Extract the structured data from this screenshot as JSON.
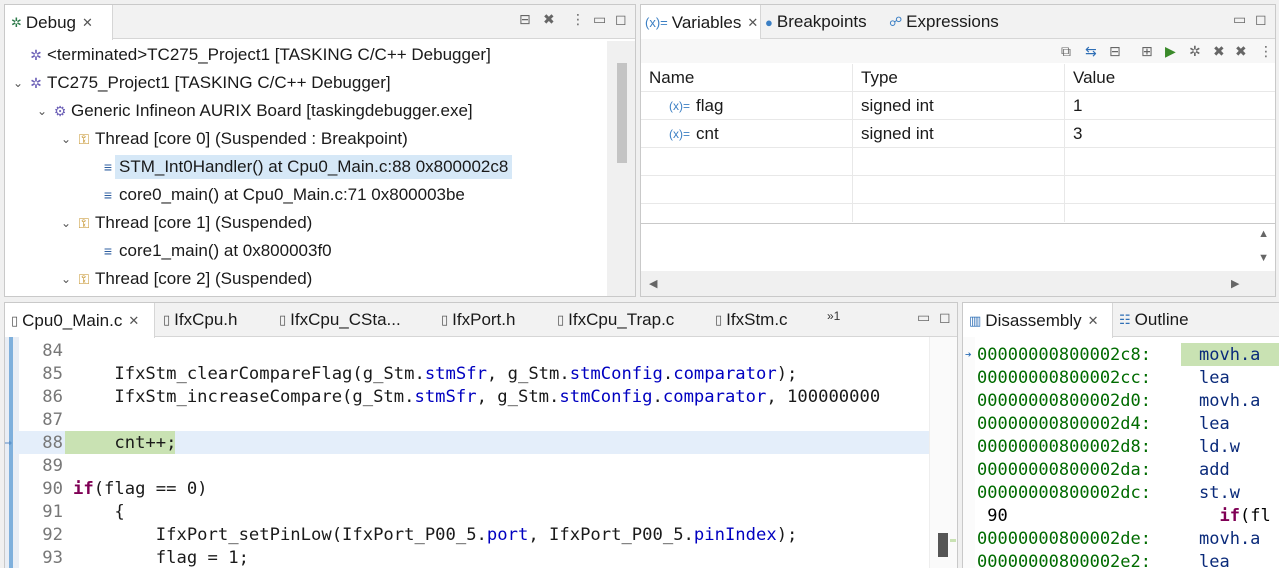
{
  "debug_view": {
    "tab_label": "Debug",
    "tree": [
      {
        "level": 1,
        "icon": "✲",
        "label": "<terminated>TC275_Project1 [TASKING C/C++ Debugger]",
        "twisty": ""
      },
      {
        "level": 1,
        "icon": "✲",
        "label": "TC275_Project1 [TASKING C/C++ Debugger]",
        "twisty": "⌄"
      },
      {
        "level": 2,
        "icon": "⚙",
        "label": "Generic Infineon AURIX Board [taskingdebugger.exe]",
        "twisty": "⌄"
      },
      {
        "level": 3,
        "icon": "⚿",
        "label": "Thread [core 0] (Suspended : Breakpoint)",
        "twisty": "⌄"
      },
      {
        "level": 4,
        "icon": "≡",
        "label": "STM_Int0Handler() at Cpu0_Main.c:88 0x800002c8",
        "twisty": "",
        "selected": true
      },
      {
        "level": 4,
        "icon": "≡",
        "label": "core0_main() at Cpu0_Main.c:71 0x800003be",
        "twisty": ""
      },
      {
        "level": 3,
        "icon": "⚿",
        "label": "Thread [core 1] (Suspended)",
        "twisty": "⌄"
      },
      {
        "level": 4,
        "icon": "≡",
        "label": "core1_main() at 0x800003f0",
        "twisty": ""
      },
      {
        "level": 3,
        "icon": "⚿",
        "label": "Thread [core 2] (Suspended)",
        "twisty": "⌄"
      }
    ]
  },
  "variables_view": {
    "tabs": [
      "Variables",
      "Breakpoints",
      "Expressions"
    ],
    "columns": [
      "Name",
      "Type",
      "Value"
    ],
    "rows": [
      {
        "name": "flag",
        "type": "signed int",
        "value": "1"
      },
      {
        "name": "cnt",
        "type": "signed int",
        "value": "3"
      }
    ]
  },
  "editor": {
    "tabs": [
      "Cpu0_Main.c",
      "IfxCpu.h",
      "IfxCpu_CSta...",
      "IfxPort.h",
      "IfxCpu_Trap.c",
      "IfxStm.c"
    ],
    "overflow_label": "»1",
    "current_line": "88",
    "lines": [
      {
        "n": "84",
        "html": ""
      },
      {
        "n": "85",
        "html": "    IfxStm_clearCompareFlag(g_Stm.<span class=\"fld\">stmSfr</span>, g_Stm.<span class=\"fld\">stmConfig</span>.<span class=\"fld\">comparator</span>);"
      },
      {
        "n": "86",
        "html": "    IfxStm_increaseCompare(g_Stm.<span class=\"fld\">stmSfr</span>, g_Stm.<span class=\"fld\">stmConfig</span>.<span class=\"fld\">comparator</span>, 100000000"
      },
      {
        "n": "87",
        "html": ""
      },
      {
        "n": "88",
        "html": "    cnt++;"
      },
      {
        "n": "89",
        "html": ""
      },
      {
        "n": "90",
        "html": "    <span class=\"kw\">if</span>(flag == 0)"
      },
      {
        "n": "91",
        "html": "    {"
      },
      {
        "n": "92",
        "html": "        IfxPort_setPinLow(IfxPort_P00_5.<span class=\"fld\">port</span>, IfxPort_P00_5.<span class=\"fld\">pinIndex</span>);"
      },
      {
        "n": "93",
        "html": "        flag = 1;"
      }
    ]
  },
  "disassembly_view": {
    "tabs": [
      "Disassembly",
      "Outline"
    ],
    "lines": [
      {
        "addr": "00000000800002c8:",
        "op": "movh.a",
        "current": true
      },
      {
        "addr": "00000000800002cc:",
        "op": "lea"
      },
      {
        "addr": "00000000800002d0:",
        "op": "movh.a"
      },
      {
        "addr": "00000000800002d4:",
        "op": "lea"
      },
      {
        "addr": "00000000800002d8:",
        "op": "ld.w"
      },
      {
        "addr": "00000000800002da:",
        "op": "add"
      },
      {
        "addr": "00000000800002dc:",
        "op": "st.w"
      },
      {
        "addr": " 90",
        "op": "  if(fl",
        "source": true
      },
      {
        "addr": "00000000800002de:",
        "op": "movh.a"
      },
      {
        "addr": "00000000800002e2:",
        "op": "lea"
      }
    ]
  },
  "colors": {
    "current_line": "#c9e2b3",
    "selection": "#d6e8f7",
    "address": "#006b00",
    "keyword": "#7f0055",
    "field": "#0000c0"
  }
}
